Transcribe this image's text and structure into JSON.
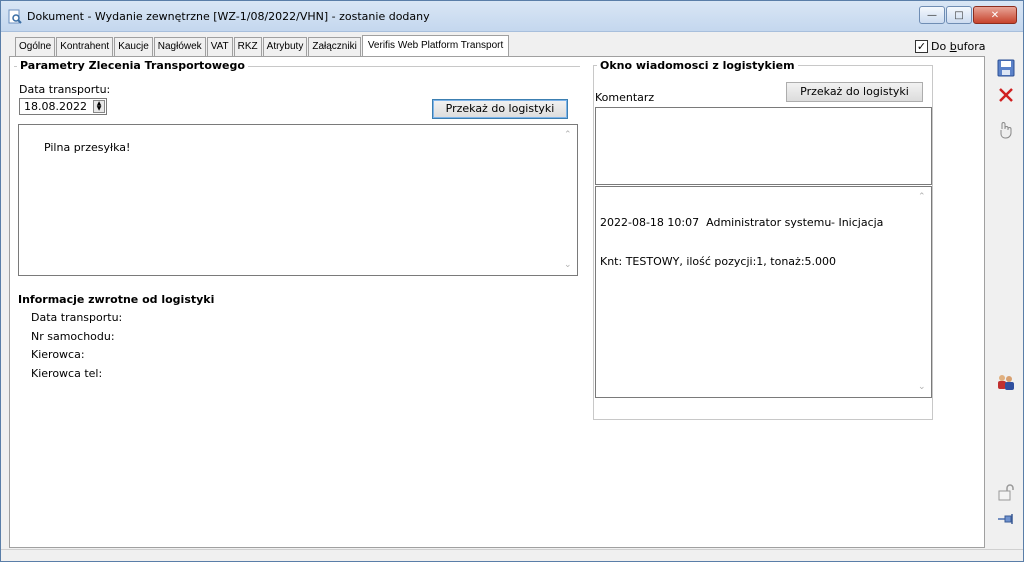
{
  "window": {
    "title": "Dokument - Wydanie zewnętrzne [WZ-1/08/2022/VHN]  - zostanie dodany"
  },
  "tabs": [
    {
      "label": "Ogólne"
    },
    {
      "label": "Kontrahent"
    },
    {
      "label": "Kaucje"
    },
    {
      "label": "Nagłówek"
    },
    {
      "label": "VAT"
    },
    {
      "label": "RKZ"
    },
    {
      "label": "Atrybuty"
    },
    {
      "label": "Załączniki"
    },
    {
      "label": "Verifis Web Platform Transport",
      "active": true
    }
  ],
  "bufor": {
    "label_pre": "Do ",
    "label_underlined": "b",
    "label_post": "ufora",
    "checked": true,
    "mark": "✓"
  },
  "params": {
    "title": "Parametry Zlecenia Transportowego",
    "date_label": "Data transportu:",
    "date_value": "18.08.2022",
    "send_button": "Przekaż do logistyki",
    "note_text": "Pilna przesyłka!"
  },
  "feedback": {
    "title": "Informacje zwrotne od logistyki",
    "fields": [
      {
        "label": "Data transportu:"
      },
      {
        "label": "Nr samochodu:"
      },
      {
        "label": "Kierowca:"
      },
      {
        "label": "Kierowca tel:"
      }
    ]
  },
  "messages": {
    "title": "Okno wiadomosci z logistykiem",
    "comment_label": "Komentarz",
    "send_button": "Przekaż do logistyki",
    "log_line1_time": "2022-08-18 10:07",
    "log_line1_user": "Administrator systemu",
    "log_line1_action": "- Inicjacja",
    "log_line2": "Knt: TESTOWY, ilość pozycji:1, tonaż:5.000"
  },
  "icons": {
    "title": "magnifier-document-icon",
    "save": "save-icon",
    "delete": "delete-icon",
    "approve": "approve-icon",
    "users": "users-icon",
    "lock": "lock-icon",
    "pin": "pin-icon"
  },
  "colors": {
    "title_bar": "#c4d7ee",
    "close_button": "#c7432c",
    "delete_icon": "#d02020",
    "save_icon": "#3b63b5"
  }
}
